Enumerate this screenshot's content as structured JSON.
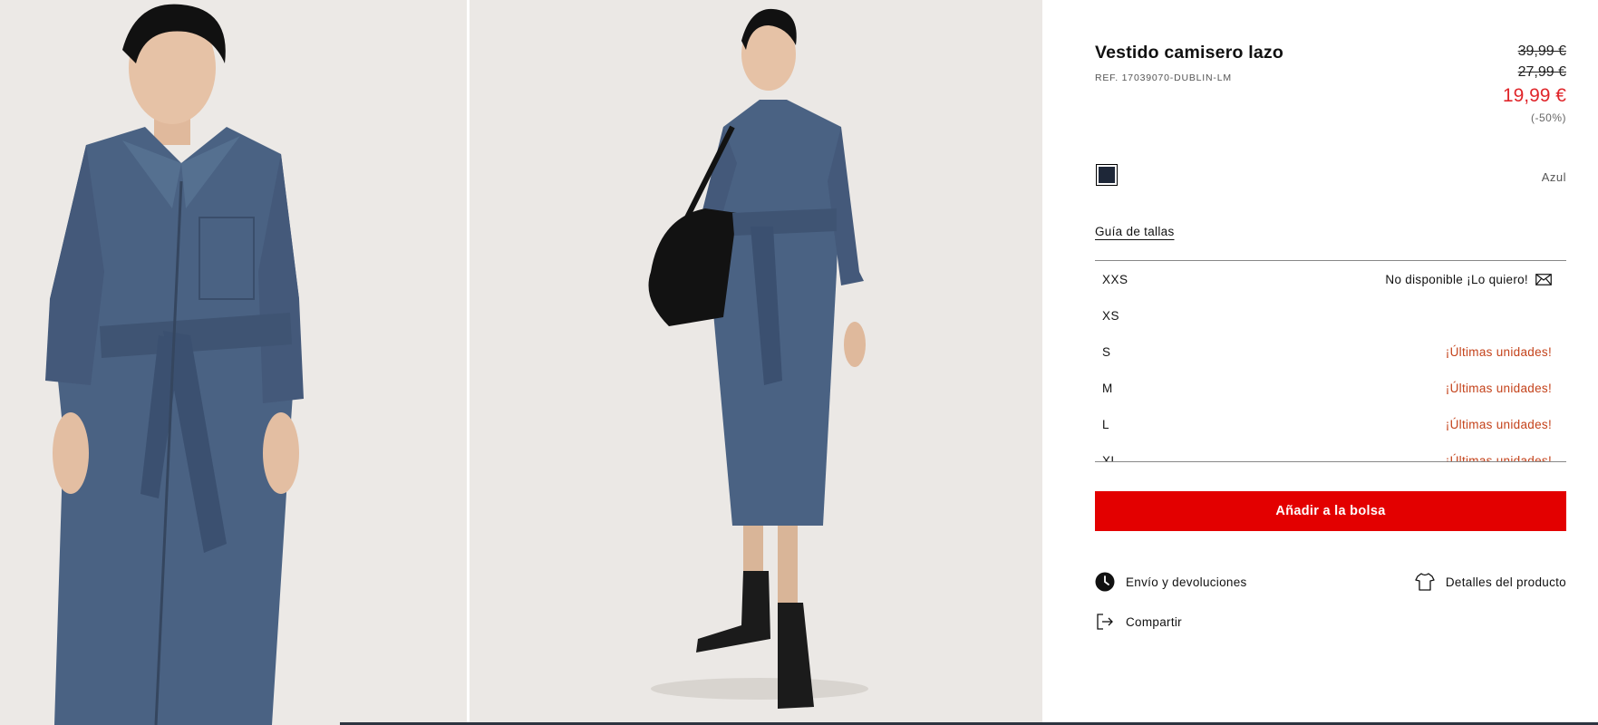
{
  "product": {
    "title": "Vestido camisero lazo",
    "ref": "REF. 17039070-DUBLIN-LM",
    "price_original": "39,99 €",
    "price_previous": "27,99 €",
    "price_current": "19,99 €",
    "discount": "(-50%)",
    "color_name": "Azul",
    "swatch_color": "#1e2738"
  },
  "size_guide_label": "Guía de tallas",
  "sizes": [
    {
      "label": "XXS",
      "status": "No disponible ¡Lo quiero!"
    },
    {
      "label": "XS",
      "status": ""
    },
    {
      "label": "S",
      "status": "¡Últimas unidades!"
    },
    {
      "label": "M",
      "status": "¡Últimas unidades!"
    },
    {
      "label": "L",
      "status": "¡Últimas unidades!"
    },
    {
      "label": "XL",
      "status": "¡Últimas unidades!"
    }
  ],
  "add_to_bag_label": "Añadir a la bolsa",
  "links": {
    "shipping": "Envío y devoluciones",
    "details": "Detalles del producto",
    "share": "Compartir"
  },
  "icons": {
    "mail": "envelope-icon",
    "shipping": "clock-icon",
    "details": "shirt-icon",
    "share": "share-icon"
  },
  "colors": {
    "accent_red": "#e30000",
    "sale_red": "#e0262b",
    "low_stock": "#c4421a",
    "dress_blue": "#4a6283"
  }
}
